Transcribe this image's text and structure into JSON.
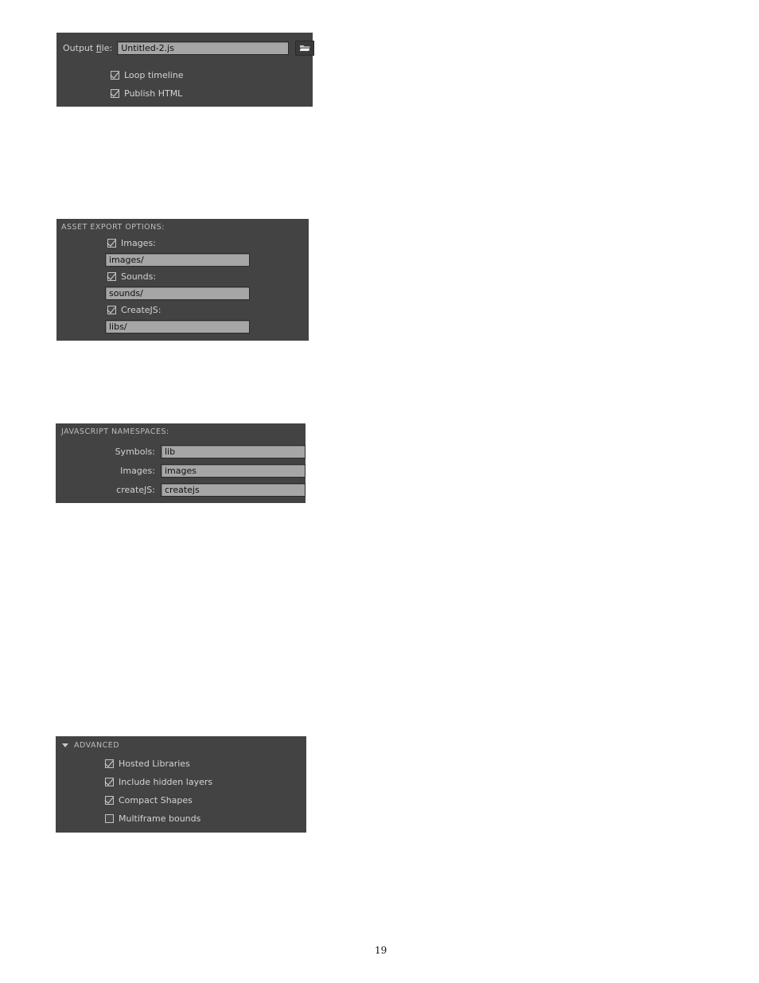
{
  "page": {
    "number": "19",
    "background_color": "#ffffff",
    "panel_color": "#434343",
    "input_color": "#a6a6a6",
    "label_color": "#d4d4d4"
  },
  "output_panel": {
    "output_file_label_pre": "Output ",
    "output_file_label_underlined": "fi",
    "output_file_label_post": "le:",
    "output_file_value": "Untitled-2.js",
    "browse_icon": "folder-open-icon",
    "checkboxes": [
      {
        "label": "Loop timeline",
        "checked": true
      },
      {
        "label": "Publish HTML",
        "checked": true
      }
    ]
  },
  "asset_export_panel": {
    "header": "ASSET EXPORT OPTIONS:",
    "items": [
      {
        "label": "Images:",
        "checked": true,
        "value": "images/"
      },
      {
        "label": "Sounds:",
        "checked": true,
        "value": "sounds/"
      },
      {
        "label": "CreateJS:",
        "checked": true,
        "value": "libs/"
      }
    ]
  },
  "namespaces_panel": {
    "header": "JAVASCRIPT NAMESPACES:",
    "fields": [
      {
        "label": "Symbols:",
        "value": "lib"
      },
      {
        "label": "Images:",
        "value": "images"
      },
      {
        "label": "createJS:",
        "value": "createjs"
      }
    ]
  },
  "advanced_panel": {
    "header": "ADVANCED",
    "disclosure_icon": "triangle-down-icon",
    "checkboxes": [
      {
        "label": "Hosted Libraries",
        "checked": true
      },
      {
        "label": "Include hidden layers",
        "checked": true
      },
      {
        "label": "Compact Shapes",
        "checked": true
      },
      {
        "label": "Multiframe bounds",
        "checked": false
      }
    ]
  }
}
